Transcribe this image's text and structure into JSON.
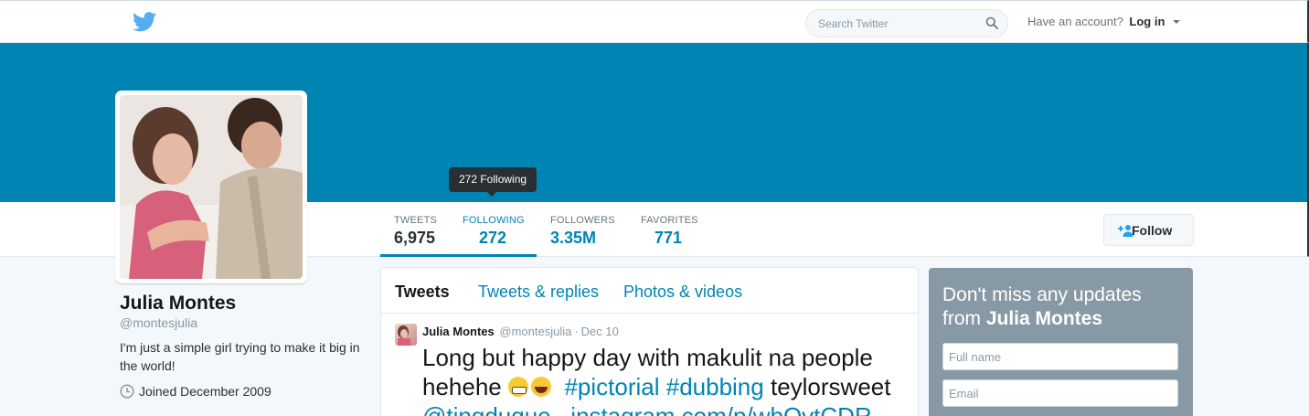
{
  "header": {
    "logo": "twitter-bird-icon",
    "search_placeholder": "Search Twitter",
    "account_prompt": "Have an account?",
    "login_label": "Log in"
  },
  "colors": {
    "brand": "#0084b4",
    "header_bird": "#55acee",
    "sidebar_card": "#8899a6"
  },
  "tooltip": "272 Following",
  "stats": [
    {
      "label": "TWEETS",
      "value": "6,975"
    },
    {
      "label": "FOLLOWING",
      "value": "272"
    },
    {
      "label": "FOLLOWERS",
      "value": "3.35M"
    },
    {
      "label": "FAVORITES",
      "value": "771"
    }
  ],
  "follow_label": "Follow",
  "profile": {
    "name": "Julia Montes",
    "handle": "@montesjulia",
    "bio": "I'm just a simple girl trying to make it big in the world!",
    "joined": "Joined December 2009"
  },
  "timeline": {
    "tabs": [
      "Tweets",
      "Tweets & replies",
      "Photos & videos"
    ],
    "tweet": {
      "name": "Julia Montes",
      "handle": "@montesjulia",
      "dot": "·",
      "time": "Dec 10",
      "text_start": "Long but happy day with makulit na people hehehe",
      "hashtags": "#pictorial #dubbing",
      "text_mid": "teylorsweet",
      "mention": "@tingduque",
      "link": "instagram.com/p/wbOvtCDR-"
    }
  },
  "signup": {
    "title_lead": "Don't miss any updates from",
    "title_name": "Julia Montes",
    "fullname_placeholder": "Full name",
    "email_placeholder": "Email"
  }
}
